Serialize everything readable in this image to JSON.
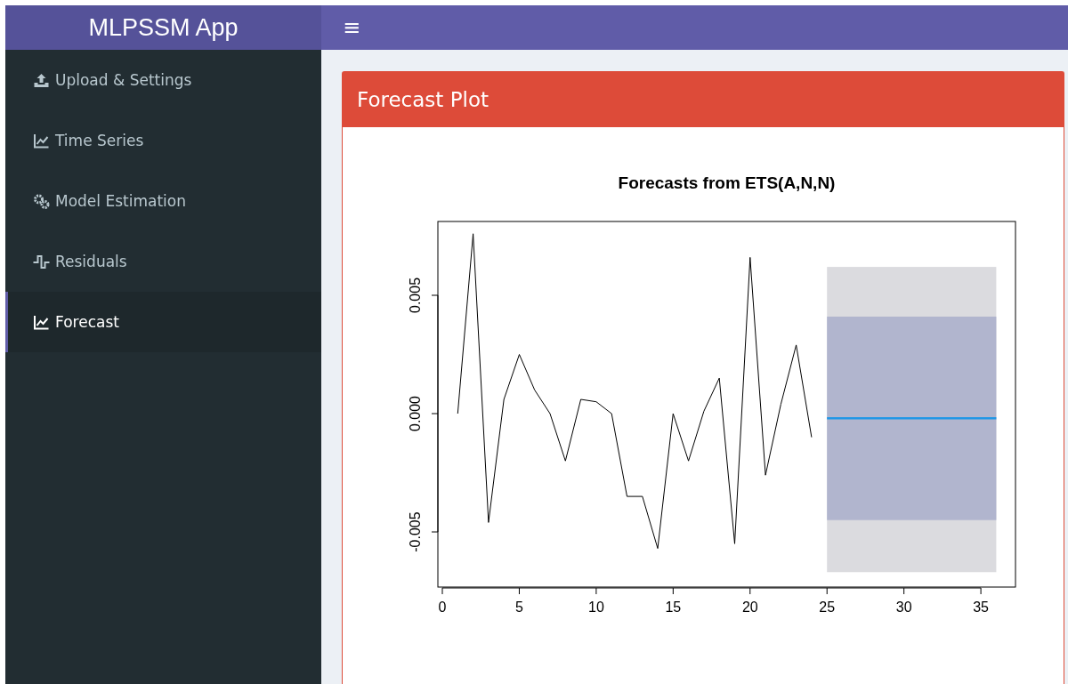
{
  "header": {
    "logo": "MLPSSM App",
    "menu_toggle": "≡"
  },
  "sidebar": {
    "items": [
      {
        "label": "Upload & Settings",
        "selected": false
      },
      {
        "label": "Time Series",
        "selected": false
      },
      {
        "label": "Model Estimation",
        "selected": false
      },
      {
        "label": "Residuals",
        "selected": false
      },
      {
        "label": "Forecast",
        "selected": true
      }
    ]
  },
  "panel": {
    "title": "Forecast Plot",
    "chart_data": {
      "type": "line",
      "title": "Forecasts from ETS(A,N,N)",
      "x": [
        1,
        2,
        3,
        4,
        5,
        6,
        7,
        8,
        9,
        10,
        11,
        12,
        13,
        14,
        15,
        16,
        17,
        18,
        19,
        20,
        21,
        22,
        23,
        24,
        25,
        26,
        27,
        28,
        29,
        30,
        31,
        32,
        33,
        34,
        35,
        36
      ],
      "series": [
        {
          "color": "#000000",
          "values": [
            0.0,
            0.0076,
            -0.0046,
            0.0006,
            0.0025,
            0.001,
            0.0,
            -0.002,
            0.0006,
            0.0005,
            0.0,
            -0.0035,
            -0.0035,
            -0.0057,
            0.0,
            -0.002,
            0.0001,
            0.0015,
            -0.0055,
            0.0066,
            -0.0026,
            0.0004,
            0.0029,
            -0.001,
            null,
            null,
            null,
            null,
            null,
            null,
            null,
            null,
            null,
            null,
            null,
            null
          ]
        },
        {
          "color": "#2297e6",
          "values": [
            null,
            null,
            null,
            null,
            null,
            null,
            null,
            null,
            null,
            null,
            null,
            null,
            null,
            null,
            null,
            null,
            null,
            null,
            null,
            null,
            null,
            null,
            null,
            null,
            -0.0002,
            -0.0002,
            -0.0002,
            -0.0002,
            -0.0002,
            -0.0002,
            -0.0002,
            -0.0002,
            -0.0002,
            -0.0002,
            -0.0002,
            -0.0002
          ]
        }
      ],
      "bands": [
        {
          "axis": "y",
          "from": -0.0067,
          "to": 0.0062,
          "color": "#dbdbdf"
        },
        {
          "axis": "y",
          "from": -0.0045,
          "to": 0.0041,
          "color": "#b1b5ce"
        }
      ],
      "xlim": [
        -0.29,
        37.25
      ],
      "ylim": [
        -0.00733,
        0.00812
      ],
      "xticks": [
        0,
        5,
        10,
        15,
        20,
        25,
        30,
        35
      ],
      "yticks": [
        {
          "value": -0.005,
          "label": "-0.005"
        },
        {
          "value": 0,
          "label": "0.000"
        },
        {
          "value": 0.005,
          "label": "0.005"
        }
      ]
    }
  }
}
